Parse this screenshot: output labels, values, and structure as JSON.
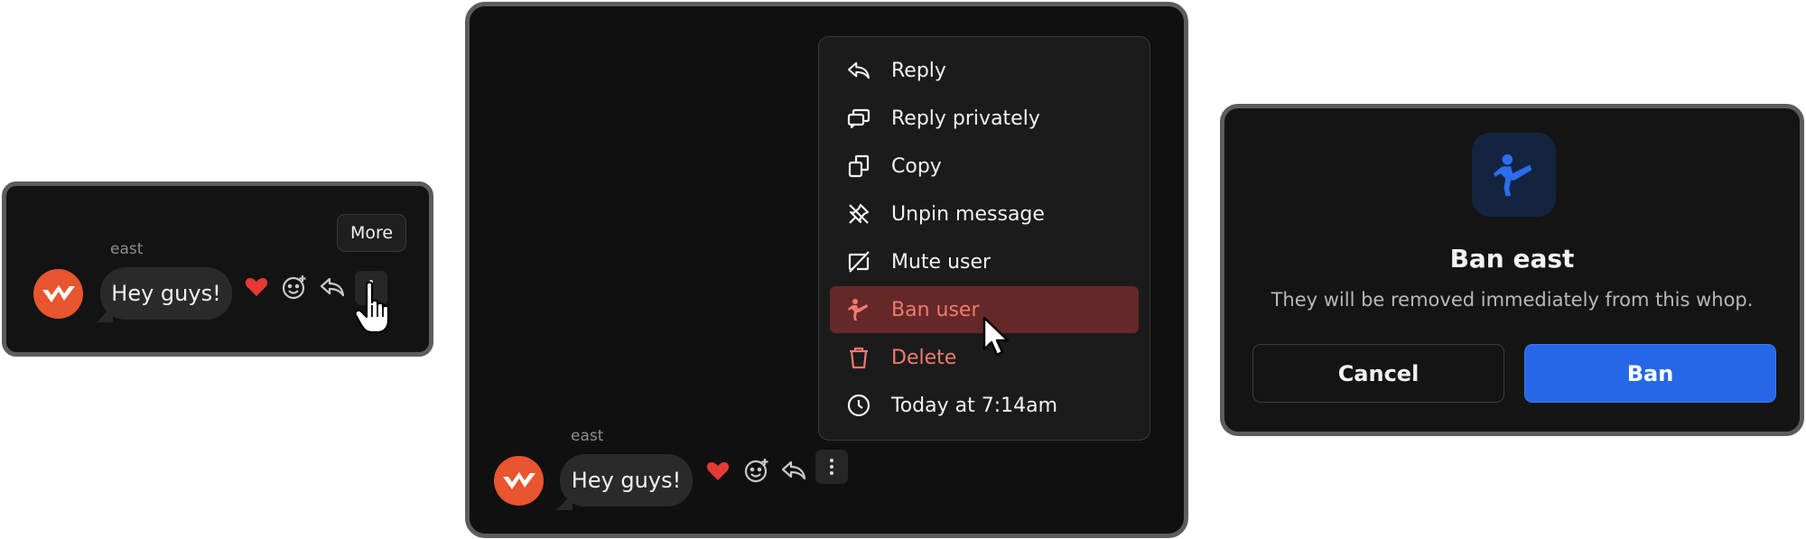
{
  "message": {
    "sender": "east",
    "text": "Hey guys!"
  },
  "tooltip": {
    "more_label": "More"
  },
  "context_menu": {
    "items": [
      {
        "label": "Reply",
        "icon": "reply-icon"
      },
      {
        "label": "Reply privately",
        "icon": "reply-privately-icon"
      },
      {
        "label": "Copy",
        "icon": "copy-icon"
      },
      {
        "label": "Unpin message",
        "icon": "unpin-icon"
      },
      {
        "label": "Mute user",
        "icon": "mute-icon"
      },
      {
        "label": "Ban user",
        "icon": "ban-user-icon"
      },
      {
        "label": "Delete",
        "icon": "trash-icon"
      },
      {
        "label": "Today at 7:14am",
        "icon": "clock-icon"
      }
    ]
  },
  "ban_dialog": {
    "title": "Ban east",
    "description": "They will be removed immediately from this whop.",
    "cancel_label": "Cancel",
    "confirm_label": "Ban"
  },
  "colors": {
    "avatar": "#e8552f",
    "danger_text": "#f07a6e",
    "danger_highlight": "#642828",
    "primary_button": "#2667e8",
    "heart": "#e53935"
  }
}
